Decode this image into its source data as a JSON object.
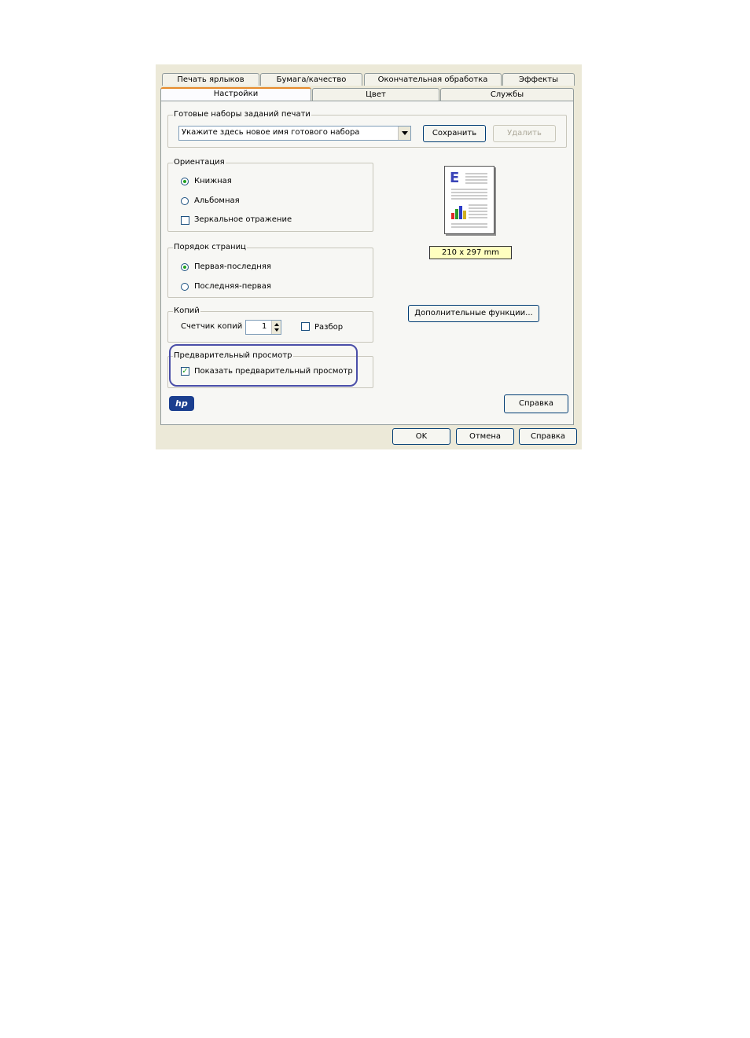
{
  "tabs_back": [
    "Печать ярлыков",
    "Бумага/качество",
    "Окончательная обработка",
    "Эффекты"
  ],
  "tabs_front": [
    "Настройки",
    "Цвет",
    "Службы"
  ],
  "presets": {
    "legend": "Готовые наборы заданий печати",
    "value": "Укажите здесь новое имя готового набора",
    "save": "Сохранить",
    "delete": "Удалить"
  },
  "orientation": {
    "legend": "Ориентация",
    "portrait": "Книжная",
    "landscape": "Альбомная",
    "mirror": "Зеркальное отражение"
  },
  "page_order": {
    "legend": "Порядок страниц",
    "first_last": "Первая-последняя",
    "last_first": "Последняя-первая"
  },
  "copies": {
    "legend": "Копий",
    "counter_label": "Счетчик копий",
    "count": "1",
    "collate": "Разбор"
  },
  "preview": {
    "legend": "Предварительный просмотр",
    "show": "Показать предварительный просмотр"
  },
  "paper": {
    "size": "210 x 297 mm",
    "preview_letter": "E"
  },
  "buttons": {
    "advanced": "Дополнительные функции...",
    "help_inner": "Справка",
    "ok": "OK",
    "cancel": "Отмена",
    "help": "Справка"
  },
  "logo": {
    "text": "hp"
  },
  "colors": {
    "highlight_ring": "#4a4ea8",
    "tab_accent": "#e68b2c",
    "logo_blue": "#1b3f8f",
    "paper_label_bg": "#ffffc0"
  }
}
